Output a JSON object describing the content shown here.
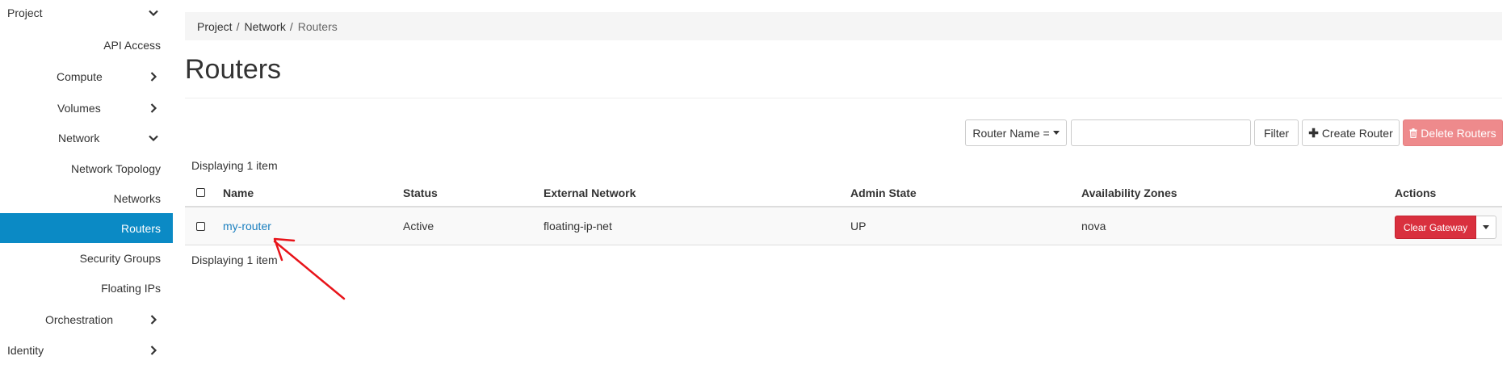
{
  "sidebar": {
    "project": "Project",
    "api_access": "API Access",
    "compute": "Compute",
    "volumes": "Volumes",
    "network": "Network",
    "network_topology": "Network Topology",
    "networks": "Networks",
    "routers": "Routers",
    "security_groups": "Security Groups",
    "floating_ips": "Floating IPs",
    "orchestration": "Orchestration",
    "identity": "Identity"
  },
  "breadcrumb": [
    "Project",
    "Network",
    "Routers"
  ],
  "page": {
    "title": "Routers"
  },
  "toolbar": {
    "filter_field": "Router Name =",
    "filter_value": "",
    "filter_label": "Filter",
    "create_label": "Create Router",
    "delete_label": "Delete Routers"
  },
  "table": {
    "count_top": "Displaying 1 item",
    "count_bottom": "Displaying 1 item",
    "columns": [
      "Name",
      "Status",
      "External Network",
      "Admin State",
      "Availability Zones",
      "Actions"
    ],
    "rows": [
      {
        "name": "my-router",
        "status": "Active",
        "external_network": "floating-ip-net",
        "admin_state": "UP",
        "availability_zones": "nova",
        "action": "Clear Gateway"
      }
    ]
  },
  "colors": {
    "active_nav": "#0b8ac5",
    "link": "#1a7fbf",
    "danger": "#d9303e",
    "danger_disabled": "#ee8a8c",
    "annotation": "#e8141a"
  },
  "icons": {
    "chevron_right": "chevron-right-icon",
    "chevron_down": "chevron-down-icon",
    "plus": "plus-icon",
    "trash": "trash-icon",
    "caret_down": "caret-down-icon"
  }
}
